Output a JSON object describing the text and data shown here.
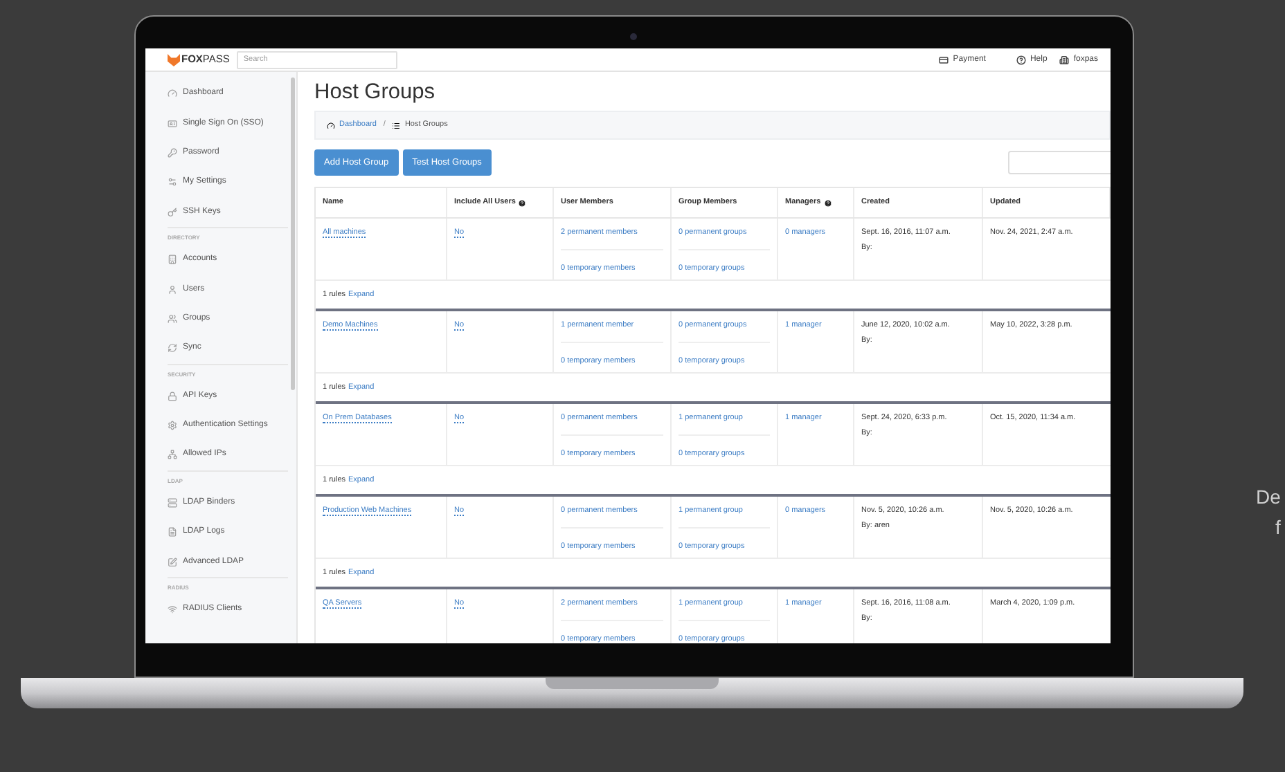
{
  "topbar": {
    "logo": "**FOX**PASS",
    "search": {
      "placeholder": "Search"
    },
    "links": [
      {
        "label": "Payment"
      },
      {
        "label": "Help"
      },
      {
        "label": "foxpas"
      }
    ]
  },
  "sidebar": {
    "sections": [
      {
        "items": [
          {
            "label": "Dashboard"
          },
          {
            "label": "Single Sign On (SSO)"
          },
          {
            "label": "Password"
          },
          {
            "label": "My Settings"
          },
          {
            "label": "SSH Keys"
          }
        ]
      },
      {
        "heading": "DIRECTORY",
        "items": [
          {
            "label": "Accounts"
          },
          {
            "label": "Users"
          },
          {
            "label": "Groups"
          },
          {
            "label": "Sync"
          }
        ]
      },
      {
        "heading": "SECURITY",
        "items": [
          {
            "label": "API Keys"
          },
          {
            "label": "Authentication Settings"
          },
          {
            "label": "Allowed IPs"
          }
        ]
      },
      {
        "heading": "LDAP",
        "items": [
          {
            "label": "LDAP Binders"
          },
          {
            "label": "LDAP Logs"
          },
          {
            "label": "Advanced LDAP"
          }
        ]
      },
      {
        "heading": "RADIUS",
        "items": [
          {
            "label": "RADIUS Clients"
          }
        ]
      }
    ]
  },
  "page": {
    "title": "Host Groups",
    "breadcrumb": [
      {
        "label": "Dashboard",
        "link": true
      },
      {
        "label": "Host Groups",
        "link": false
      }
    ],
    "separator": "/",
    "buttons": [
      "Add Host Group",
      "Test Host Groups"
    ]
  },
  "table": {
    "columns": [
      {
        "label": "Name",
        "help": false
      },
      {
        "label": "Include All Users",
        "help": true
      },
      {
        "label": "User Members",
        "help": false
      },
      {
        "label": "Group Members",
        "help": false
      },
      {
        "label": "Managers",
        "help": true
      },
      {
        "label": "Created",
        "help": false
      },
      {
        "label": "Updated",
        "help": false
      }
    ],
    "rows": [
      {
        "name": "All machines",
        "include_all_users": "No",
        "user_members": [
          "2 permanent members",
          "0 temporary members"
        ],
        "group_members": [
          "0 permanent groups",
          "0 temporary groups"
        ],
        "managers": "0 managers",
        "created": "Sept. 16, 2016, 11:07 a.m.",
        "created_by": "By:",
        "updated": "Nov. 24, 2021, 2:47 a.m.",
        "rules": "1 rules",
        "expand": "Expand"
      },
      {
        "name": "Demo Machines",
        "include_all_users": "No",
        "user_members": [
          "1 permanent member",
          "0 temporary members"
        ],
        "group_members": [
          "0 permanent groups",
          "0 temporary groups"
        ],
        "managers": "1 manager",
        "created": "June 12, 2020, 10:02 a.m.",
        "created_by": "By:",
        "updated": "May 10, 2022, 3:28 p.m.",
        "rules": "1 rules",
        "expand": "Expand"
      },
      {
        "name": "On Prem Databases",
        "include_all_users": "No",
        "user_members": [
          "0 permanent members",
          "0 temporary members"
        ],
        "group_members": [
          "1 permanent group",
          "0 temporary groups"
        ],
        "managers": "1 manager",
        "created": "Sept. 24, 2020, 6:33 p.m.",
        "created_by": "By:",
        "updated": "Oct. 15, 2020, 11:34 a.m.",
        "rules": "1 rules",
        "expand": "Expand"
      },
      {
        "name": "Production Web Machines",
        "include_all_users": "No",
        "user_members": [
          "0 permanent members",
          "0 temporary members"
        ],
        "group_members": [
          "1 permanent group",
          "0 temporary groups"
        ],
        "managers": "0 managers",
        "created": "Nov. 5, 2020, 10:26 a.m.",
        "created_by": "By: aren",
        "updated": "Nov. 5, 2020, 10:26 a.m.",
        "rules": "1 rules",
        "expand": "Expand"
      },
      {
        "name": "QA Servers",
        "include_all_users": "No",
        "user_members": [
          "2 permanent members",
          "0 temporary members"
        ],
        "group_members": [
          "1 permanent group",
          "0 temporary groups"
        ],
        "managers": "1 manager",
        "created": "Sept. 16, 2016, 11:08 a.m.",
        "created_by": "By:",
        "updated": "March 4, 2020, 1:09 p.m."
      }
    ]
  },
  "side_text": [
    "De",
    "f"
  ]
}
